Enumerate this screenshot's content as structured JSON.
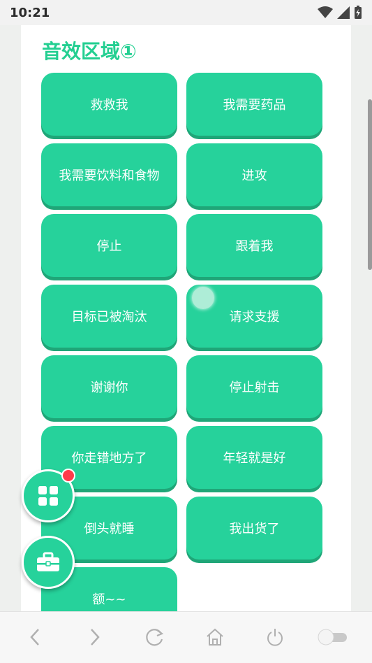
{
  "status_bar": {
    "time": "10:21",
    "icons": [
      "wifi-icon",
      "signal-icon",
      "battery-charging-icon"
    ]
  },
  "section": {
    "title": "音效区域①"
  },
  "sound_buttons": [
    "救救我",
    "我需要药品",
    "我需要饮料和食物",
    "进攻",
    "停止",
    "跟着我",
    "目标已被淘汰",
    "请求支援",
    "谢谢你",
    "停止射击",
    "你走错地方了",
    "年轻就是好",
    "倒头就睡",
    "我出货了",
    "额~~"
  ],
  "floating_buttons": [
    {
      "name": "apps-grid-icon",
      "badge": true
    },
    {
      "name": "toolbox-icon",
      "badge": false
    }
  ],
  "nav_bar": [
    "back-icon",
    "forward-icon",
    "refresh-icon",
    "home-icon",
    "power-icon",
    "toggle-switch"
  ],
  "colors": {
    "accent": "#26d29b",
    "accent_shadow": "#1fa678",
    "title": "#23cf91",
    "badge": "#ff3b4a"
  }
}
